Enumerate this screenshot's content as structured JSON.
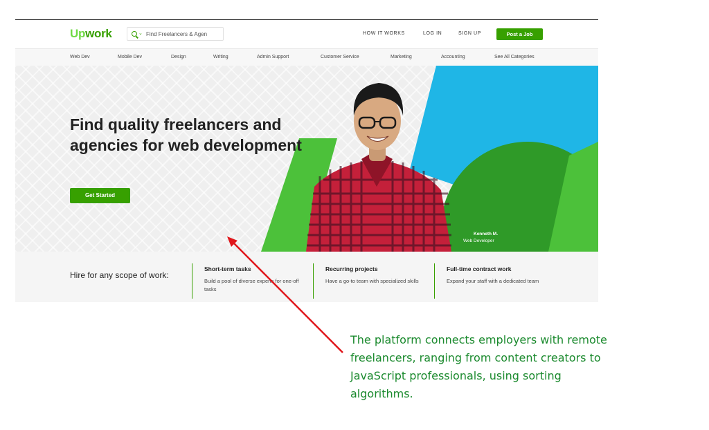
{
  "header": {
    "logo_up": "Up",
    "logo_work": "work",
    "search_placeholder": "Find Freelancers & Agen",
    "nav": [
      "HOW IT WORKS",
      "LOG IN",
      "SIGN UP"
    ],
    "post_job": "Post a Job"
  },
  "categories": [
    "Web Dev",
    "Mobile Dev",
    "Design",
    "Writing",
    "Admin Support",
    "Customer Service",
    "Marketing",
    "Accounting",
    "See All Categories"
  ],
  "hero": {
    "title": "Find quality freelancers and agencies for web development",
    "cta": "Get Started",
    "person_name": "Kenneth M.",
    "person_role": "Web Developer",
    "colors": {
      "green_light": "#4cc13a",
      "green_dark": "#2f9a28",
      "blue": "#1fb6e6",
      "brand_green": "#37a000"
    }
  },
  "scope": {
    "lead": "Hire for any scope of work:",
    "items": [
      {
        "title": "Short-term tasks",
        "desc": "Build a pool of diverse experts for one-off tasks"
      },
      {
        "title": "Recurring projects",
        "desc": "Have a go-to team with specialized skills"
      },
      {
        "title": "Full-time contract work",
        "desc": "Expand your staff with a dedicated team"
      }
    ]
  },
  "annotation": {
    "text": "The platform connects employers with remote freelancers, ranging from content creators to JavaScript professionals, using sorting algorithms.",
    "arrow_color": "#e0161b",
    "text_color": "#1b8a2e"
  }
}
